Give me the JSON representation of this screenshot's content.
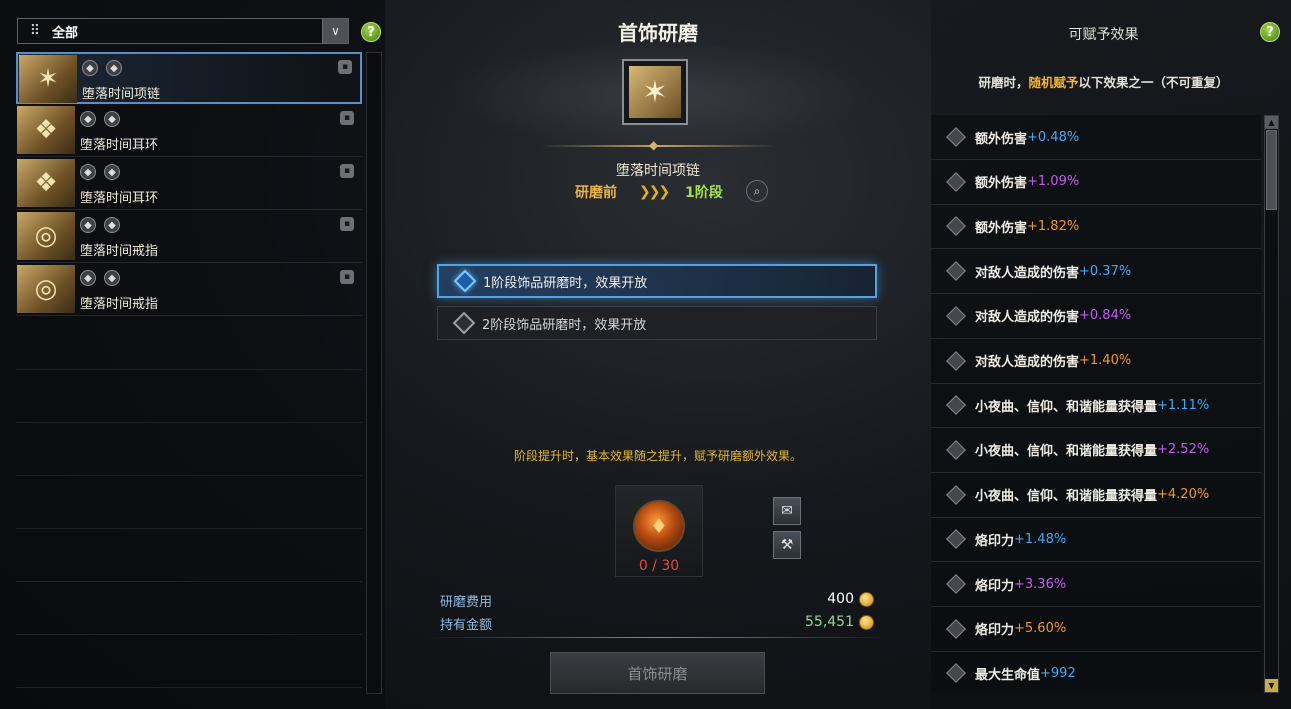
{
  "filter": {
    "grid_icon": "grid-icon",
    "label": "全部",
    "dropdown_icon": "chevron-down-icon"
  },
  "help_icon": "?",
  "items": [
    {
      "name": "堕落时间项链",
      "selected": true,
      "glyph": "✶"
    },
    {
      "name": "堕落时间耳环",
      "selected": false,
      "glyph": "❖"
    },
    {
      "name": "堕落时间耳环",
      "selected": false,
      "glyph": "❖"
    },
    {
      "name": "堕落时间戒指",
      "selected": false,
      "glyph": "◎"
    },
    {
      "name": "堕落时间戒指",
      "selected": false,
      "glyph": "◎"
    }
  ],
  "center": {
    "title": "首饰研磨",
    "item_name": "堕落时间项链",
    "stage_before": "研磨前",
    "stage_arrows": "❯❯❯",
    "stage_after": "1阶段",
    "options": [
      "1阶段饰品研磨时，效果开放",
      "2阶段饰品研磨时，效果开放"
    ],
    "notice": "阶段提升时，基本效果随之提升，赋予研磨额外效果。",
    "material_count": "0 / 30",
    "cost_label": "研磨费用",
    "cost_value": "400",
    "owned_label": "持有金额",
    "owned_value": "55,451",
    "main_button": "首饰研磨"
  },
  "right": {
    "title": "可赋予效果",
    "sub_prefix": "研磨时，",
    "sub_highlight": "随机赋予",
    "sub_suffix": "以下效果之一（不可重复）",
    "effects": [
      {
        "label": "额外伤害",
        "value": "+0.48%",
        "color": "blue"
      },
      {
        "label": "额外伤害",
        "value": "+1.09%",
        "color": "purple"
      },
      {
        "label": "额外伤害",
        "value": "+1.82%",
        "color": "orange"
      },
      {
        "label": "对敌人造成的伤害",
        "value": "+0.37%",
        "color": "blue"
      },
      {
        "label": "对敌人造成的伤害",
        "value": "+0.84%",
        "color": "purple"
      },
      {
        "label": "对敌人造成的伤害",
        "value": "+1.40%",
        "color": "orange"
      },
      {
        "label": "小夜曲、信仰、和谐能量获得量",
        "value": "+1.11%",
        "color": "blue"
      },
      {
        "label": "小夜曲、信仰、和谐能量获得量",
        "value": "+2.52%",
        "color": "purple"
      },
      {
        "label": "小夜曲、信仰、和谐能量获得量",
        "value": "+4.20%",
        "color": "orange"
      },
      {
        "label": "烙印力",
        "value": "+1.48%",
        "color": "blue"
      },
      {
        "label": "烙印力",
        "value": "+3.36%",
        "color": "purple"
      },
      {
        "label": "烙印力",
        "value": "+5.60%",
        "color": "orange"
      },
      {
        "label": "最大生命值",
        "value": "+992",
        "color": "blue"
      }
    ]
  },
  "colors": {
    "blue": "#3fa9f5",
    "purple": "#c55af0",
    "orange": "#f0962b",
    "gold": "#e5b630",
    "green": "#a6e04a"
  }
}
